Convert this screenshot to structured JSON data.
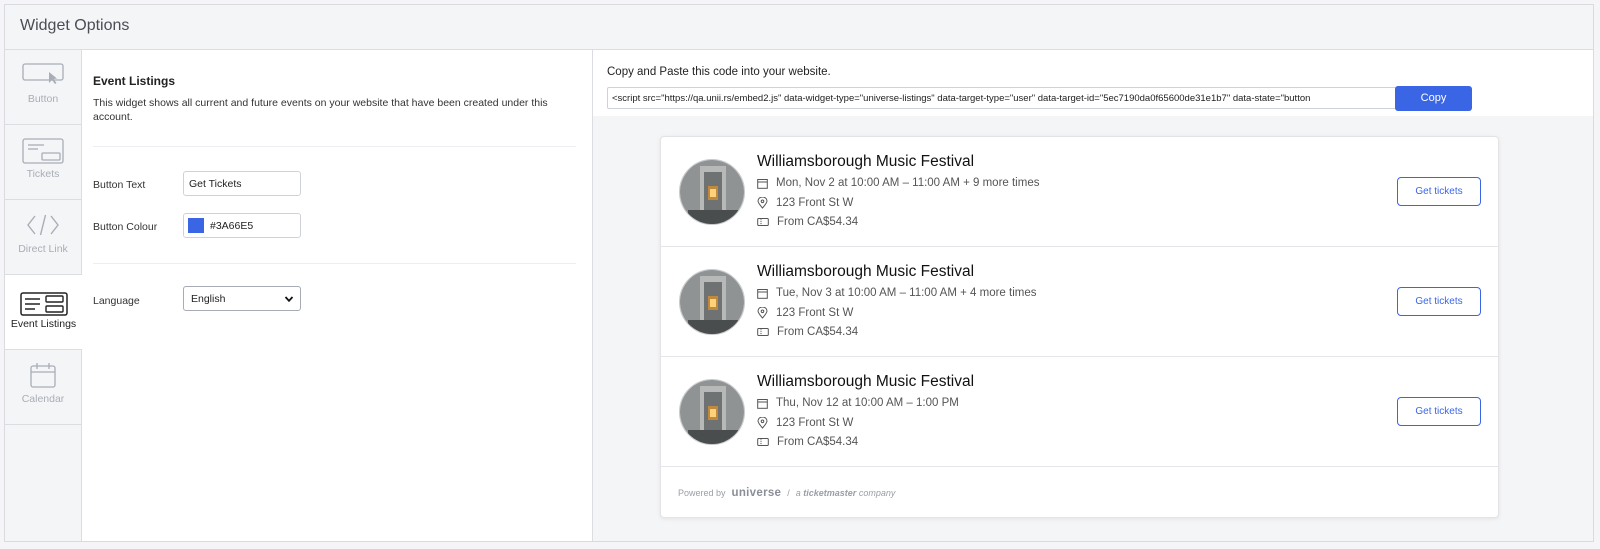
{
  "header": {
    "title": "Widget Options"
  },
  "sidebar": {
    "items": [
      {
        "label": "Button",
        "icon": "button-icon",
        "active": false
      },
      {
        "label": "Tickets",
        "icon": "tickets-icon",
        "active": false
      },
      {
        "label": "Direct Link",
        "icon": "code-icon",
        "active": false
      },
      {
        "label": "Event Listings",
        "icon": "event-listings-icon",
        "active": true
      },
      {
        "label": "Calendar",
        "icon": "calendar-icon",
        "active": false
      }
    ]
  },
  "options": {
    "title": "Event Listings",
    "description": "This widget shows all current and future events on your website that have been created under this account.",
    "button_text_label": "Button Text",
    "button_text_value": "Get Tickets",
    "button_colour_label": "Button Colour",
    "button_colour_value": "#3A66E5",
    "language_label": "Language",
    "language_value": "English"
  },
  "code": {
    "title": "Copy and Paste this code into your website.",
    "snippet": "<script  src=\"https://qa.unii.rs/embed2.js\"  data-widget-type=\"universe-listings\"  data-target-type=\"user\"  data-target-id=\"5ec7190da0f65600de31e1b7\"  data-state=\"button",
    "copy_label": "Copy"
  },
  "events": [
    {
      "name": "Williamsborough Music Festival",
      "date": "Mon, Nov 2 at 10:00 AM – 11:00 AM + 9 more times",
      "location": "123 Front St W",
      "price": "From CA$54.34",
      "button": "Get tickets"
    },
    {
      "name": "Williamsborough Music Festival",
      "date": "Tue, Nov 3 at 10:00 AM – 11:00 AM + 4 more times",
      "location": "123 Front St W",
      "price": "From CA$54.34",
      "button": "Get tickets"
    },
    {
      "name": "Williamsborough Music Festival",
      "date": "Thu, Nov 12 at 10:00 AM – 1:00 PM",
      "location": "123 Front St W",
      "price": "From CA$54.34",
      "button": "Get tickets"
    }
  ],
  "footer": {
    "powered_by": "Powered by",
    "brand": "universe",
    "separator": "/",
    "tagline_prefix": "a",
    "tagline_brand": "ticketmaster",
    "tagline_suffix": "company"
  },
  "colors": {
    "accent": "#3A66E5"
  }
}
